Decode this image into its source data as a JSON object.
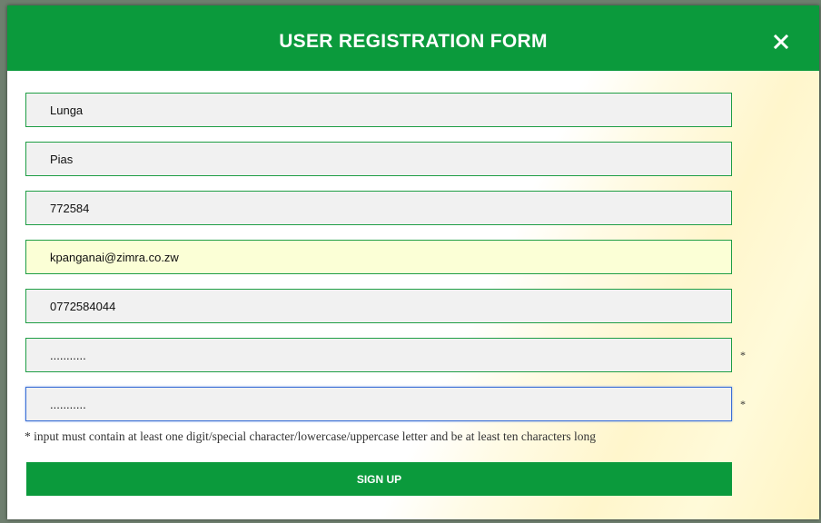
{
  "modal": {
    "title": "USER REGISTRATION FORM",
    "close_icon": "close-icon",
    "colors": {
      "header": "#0b9a3c",
      "field_border": "#1f9e45",
      "autofill": "#fbffd6"
    }
  },
  "form": {
    "first_name": "Lunga",
    "last_name": "Pias",
    "employee_number": "772584",
    "email": "kpanganai@zimra.co.zw",
    "phone": "0772584044",
    "password": "...........",
    "confirm_password": "...........",
    "required_marker": "*",
    "hint": "* input must contain at least one digit/special character/lowercase/uppercase letter and be at least ten characters long",
    "submit_label": "SIGN UP"
  }
}
